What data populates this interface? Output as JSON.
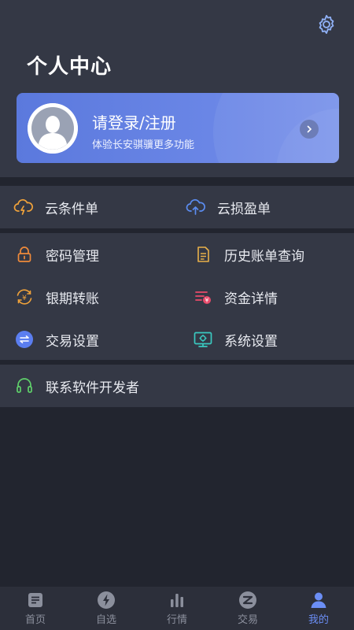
{
  "header": {
    "title": "个人中心",
    "settings_icon": "gear-icon"
  },
  "login_card": {
    "title": "请登录/注册",
    "subtitle": "体验长安骐骥更多功能",
    "gradient_start": "#5b79dd",
    "gradient_end": "#7a93ea"
  },
  "cloud_menu": [
    {
      "label": "云条件单",
      "icon": "cloud-lightning-icon",
      "color": "#f0a23a"
    },
    {
      "label": "云损盈单",
      "icon": "cloud-upload-icon",
      "color": "#5b8cf0"
    }
  ],
  "main_menu": [
    {
      "label": "密码管理",
      "icon": "lock-icon",
      "color": "#f08a3a"
    },
    {
      "label": "历史账单查询",
      "icon": "document-icon",
      "color": "#e8b04a"
    },
    {
      "label": "银期转账",
      "icon": "yen-exchange-icon",
      "color": "#f0a23a"
    },
    {
      "label": "资金详情",
      "icon": "fund-list-icon",
      "color": "#e84a6a"
    },
    {
      "label": "交易设置",
      "icon": "exchange-icon",
      "color": "#5b7ef0"
    },
    {
      "label": "系统设置",
      "icon": "monitor-icon",
      "color": "#3ac9c0"
    }
  ],
  "contact": {
    "label": "联系软件开发者",
    "icon": "headset-icon",
    "color": "#5fd06a"
  },
  "tabs": [
    {
      "label": "首页",
      "icon": "home-icon",
      "active": false
    },
    {
      "label": "自选",
      "icon": "lightning-icon",
      "active": false
    },
    {
      "label": "行情",
      "icon": "bar-chart-icon",
      "active": false
    },
    {
      "label": "交易",
      "icon": "trade-icon",
      "active": false
    },
    {
      "label": "我的",
      "icon": "person-icon",
      "active": true
    }
  ]
}
